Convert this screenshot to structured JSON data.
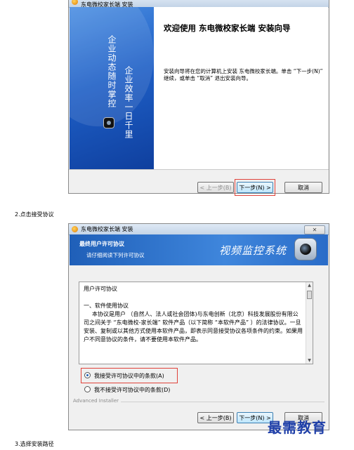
{
  "window1": {
    "title": "东电微校家长端 安装",
    "close_label": "✕",
    "sidebar": {
      "slogan_left": "企业动态随时掌控",
      "slogan_right": "企业效率一日千里"
    },
    "welcome_title": "欢迎使用 东电微校家长端 安装向导",
    "welcome_desc": "安装向导将在您的计算机上安装 东电微校家长端。单击 “下一步(N)” 继续，或单击 “取消” 退出安装向导。",
    "buttons": {
      "back": "< 上一步(B)",
      "next": "下一步(N) >",
      "cancel": "取消"
    }
  },
  "caption_step2": "2.点击接受协议",
  "window2": {
    "title": "东电微校家长端 安装",
    "close_label": "✕",
    "header_title": "最终用户许可协议",
    "header_sub": "请仔细阅读下列许可协议",
    "brand": "视频监控系统",
    "license_heading": "用户许可协议",
    "license_section": "一、软件使用协议",
    "license_body": "本协议是用户 （自然人、法人或社会团体)与东电创新（北京）科技发展股份有限公司之间关于 “东电微校-家长端” 软件产品（以下简称 “本软件产品” ）的法律协议。一旦安装、复制或以其他方式使用本软件产品，即表示同意接受协议各项条件的约束。如果用户不同意协议的条件，请不要使用本软件产品。",
    "radio_accept": "我接受许可协议中的条款(A)",
    "radio_decline": "我不接受许可协议中的条款(D)",
    "installer_label": "Advanced Installer",
    "buttons": {
      "back": "< 上一步(B)",
      "next": "下一步(N) >",
      "cancel": "取消"
    }
  },
  "caption_step3": "3.选择安装路径",
  "watermark": "最需教育"
}
